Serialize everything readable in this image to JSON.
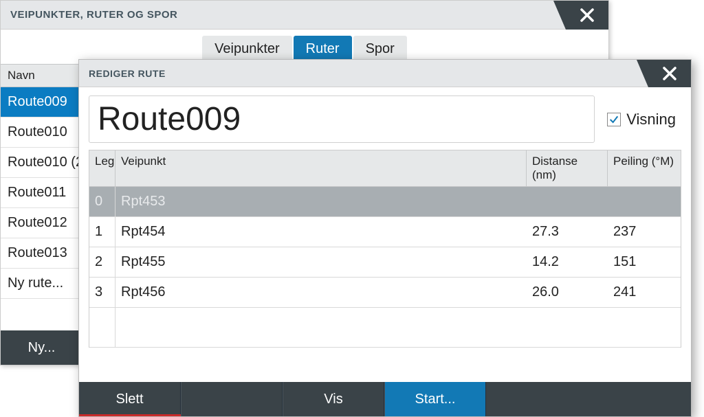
{
  "back": {
    "title": "VEIPUNKTER, RUTER OG SPOR",
    "tabs": {
      "waypoints": "Veipunkter",
      "routes": "Ruter",
      "tracks": "Spor"
    },
    "headers": {
      "name": "Navn"
    },
    "rows": [
      "Route009",
      "Route010",
      "Route010 (2)",
      "Route011",
      "Route012",
      "Route013",
      "Ny rute..."
    ],
    "actions": {
      "new": "Ny..."
    }
  },
  "front": {
    "title": "REDIGER RUTE",
    "route_name": "Route009",
    "display_label": "Visning",
    "display_checked": true,
    "headers": {
      "leg": "Leg",
      "waypoint": "Veipunkt",
      "distance": "Distanse (nm)",
      "bearing": "Peiling (°M)"
    },
    "rows": [
      {
        "leg": "0",
        "wp": "Rpt453",
        "dist": "",
        "bear": ""
      },
      {
        "leg": "1",
        "wp": "Rpt454",
        "dist": "27.3",
        "bear": "237"
      },
      {
        "leg": "2",
        "wp": "Rpt455",
        "dist": "14.2",
        "bear": "151"
      },
      {
        "leg": "3",
        "wp": "Rpt456",
        "dist": "26.0",
        "bear": "241"
      }
    ],
    "actions": {
      "delete": "Slett",
      "show": "Vis",
      "start": "Start..."
    }
  }
}
